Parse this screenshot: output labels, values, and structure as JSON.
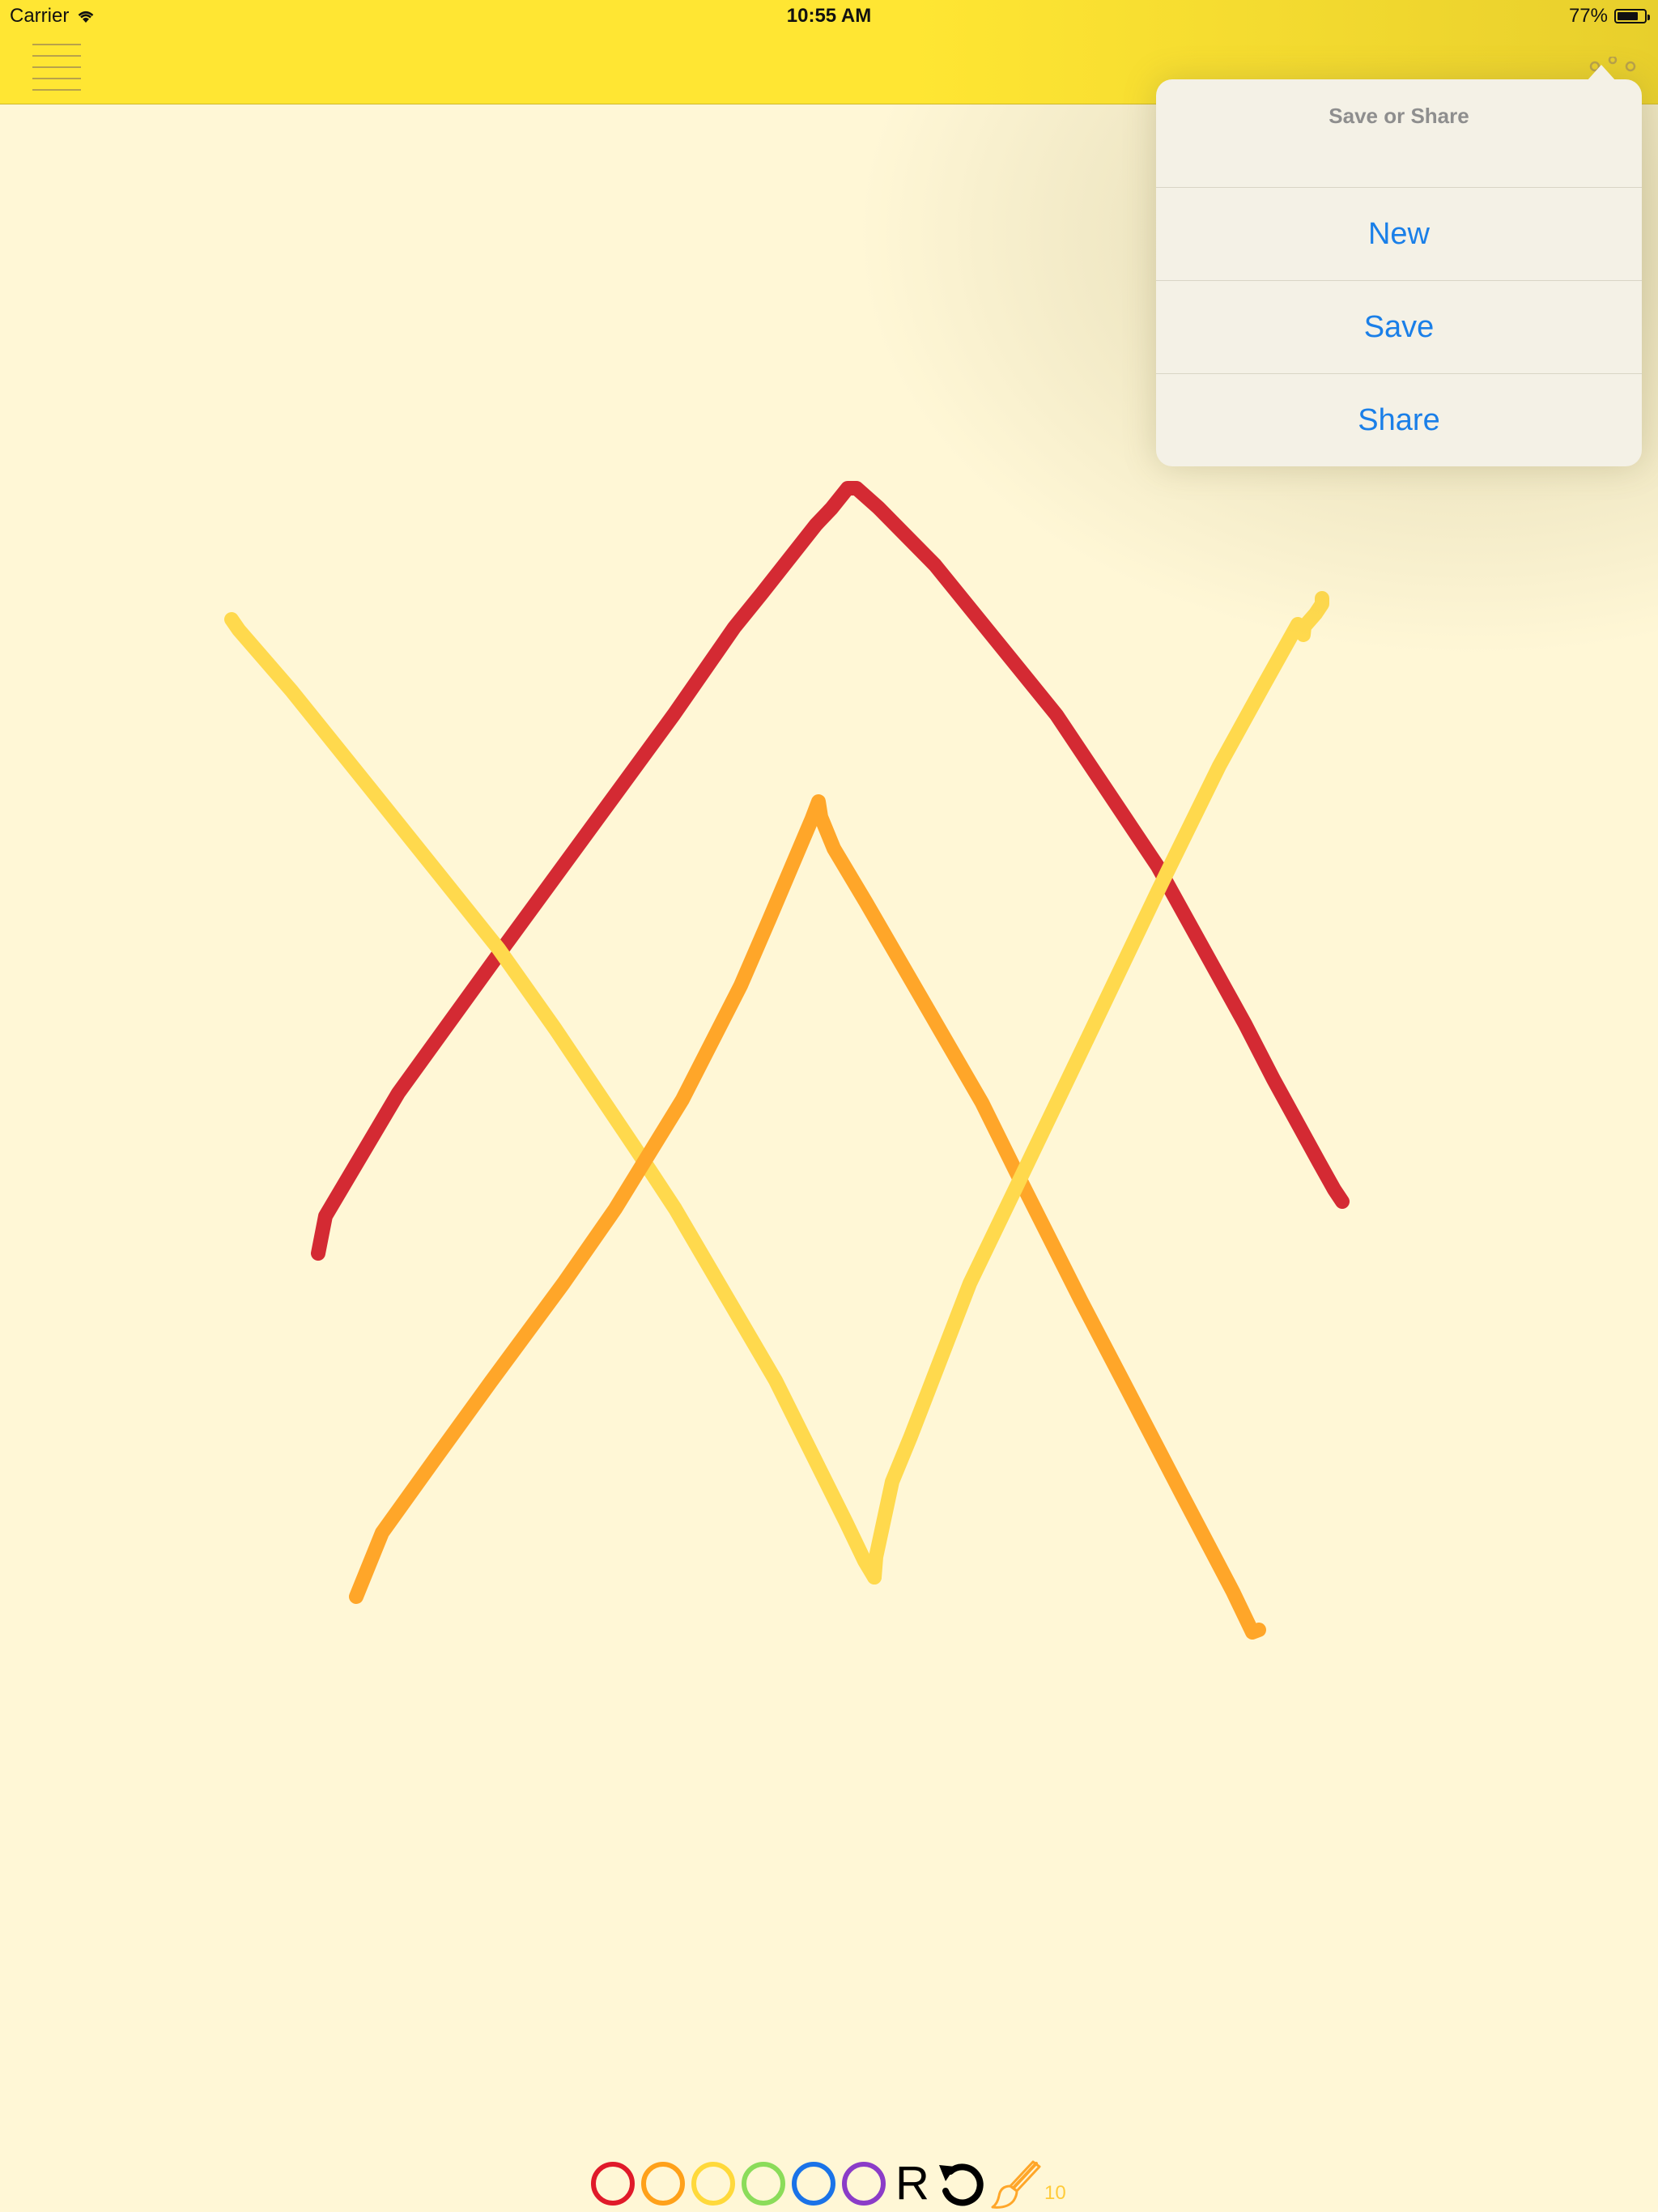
{
  "status_bar": {
    "carrier": "Carrier",
    "time": "10:55 AM",
    "battery_percent": "77%",
    "battery_level": 0.77
  },
  "nav_bar": {
    "menu_icon": "hamburger-menu-icon",
    "share_icon": "share-icon",
    "background_color": "#ffe633"
  },
  "popover": {
    "title": "Save or Share",
    "items": [
      {
        "label": "New"
      },
      {
        "label": "Save"
      },
      {
        "label": "Share"
      }
    ],
    "action_color": "#1a7fe8"
  },
  "drawing": {
    "background_color": "#fff7d6",
    "strokes": [
      {
        "color": "#d42a33"
      },
      {
        "color": "#ffd94d"
      },
      {
        "color": "#ffa629"
      },
      {
        "color": "#ffd94d"
      }
    ]
  },
  "toolbar": {
    "colors": [
      {
        "name": "red",
        "hex": "#e01a2a"
      },
      {
        "name": "orange",
        "hex": "#ffa11a"
      },
      {
        "name": "yellow",
        "hex": "#ffd93b"
      },
      {
        "name": "green",
        "hex": "#8bdc5a"
      },
      {
        "name": "blue",
        "hex": "#1a73e8"
      },
      {
        "name": "purple",
        "hex": "#8b3cc8"
      }
    ],
    "reset_label": "R",
    "undo_icon": "undo-icon",
    "brush_icon": "paintbrush-icon",
    "brush_size": "10"
  }
}
